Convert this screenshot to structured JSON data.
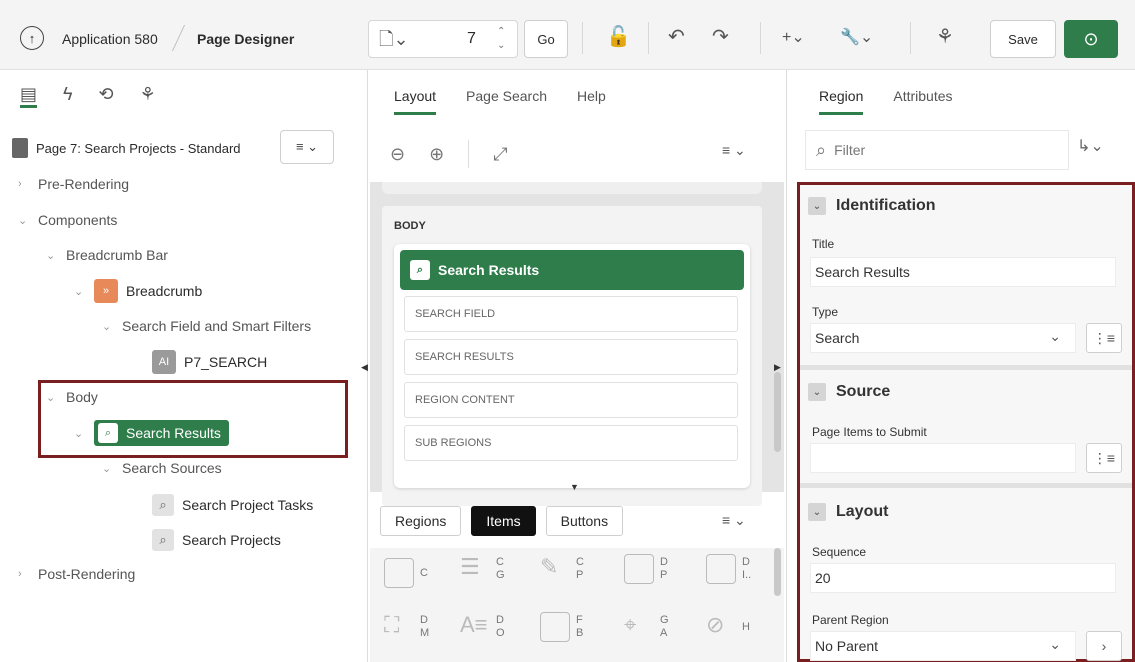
{
  "header": {
    "app_name": "Application 580",
    "page_designer": "Page Designer",
    "page_number": "7",
    "go_label": "Go",
    "save_label": "Save",
    "add_label": "+⌄",
    "wrench_label": "🔧⌄"
  },
  "left": {
    "page_label": "Page 7: Search Projects - Standard",
    "tree": [
      {
        "label": "Pre-Rendering",
        "level": 0,
        "chev": "›"
      },
      {
        "label": "Components",
        "level": 0,
        "chev": "⌄"
      },
      {
        "label": "Breadcrumb Bar",
        "level": 1,
        "chev": "⌄"
      },
      {
        "label": "Breadcrumb",
        "level": 2,
        "chev": "⌄"
      },
      {
        "label": "Search Field and Smart Filters",
        "level": 3,
        "chev": "⌄"
      },
      {
        "label": "P7_SEARCH",
        "level": 4,
        "chev": ""
      },
      {
        "label": "Body",
        "level": 1,
        "chev": "⌄"
      },
      {
        "label": "Search Results",
        "level": 2,
        "chev": "⌄"
      },
      {
        "label": "Search Sources",
        "level": 3,
        "chev": "⌄"
      },
      {
        "label": "Search Project Tasks",
        "level": 4,
        "chev": ""
      },
      {
        "label": "Search Projects",
        "level": 4,
        "chev": ""
      },
      {
        "label": "Post-Rendering",
        "level": 0,
        "chev": "›"
      }
    ]
  },
  "middle": {
    "tabs": [
      "Layout",
      "Page Search",
      "Help"
    ],
    "body_label": "BODY",
    "card_title": "Search Results",
    "slots": [
      "SEARCH FIELD",
      "SEARCH RESULTS",
      "REGION CONTENT",
      "SUB REGIONS"
    ],
    "gallery_tabs": [
      "Regions",
      "Items",
      "Buttons"
    ],
    "gallery_items": [
      {
        "l1": "C",
        "l2": ""
      },
      {
        "l1": "C",
        "l2": "G"
      },
      {
        "l1": "C",
        "l2": "P"
      },
      {
        "l1": "D",
        "l2": "P"
      },
      {
        "l1": "D",
        "l2": "I.."
      },
      {
        "l1": "D",
        "l2": "M"
      },
      {
        "l1": "D",
        "l2": "O"
      },
      {
        "l1": "F",
        "l2": "B"
      },
      {
        "l1": "G",
        "l2": "A"
      },
      {
        "l1": "H",
        "l2": ""
      }
    ]
  },
  "right": {
    "tabs": [
      "Region",
      "Attributes"
    ],
    "filter_placeholder": "Filter",
    "sections": {
      "identification": "Identification",
      "source": "Source",
      "layout": "Layout"
    },
    "title_label": "Title",
    "title_value": "Search Results",
    "type_label": "Type",
    "type_value": "Search",
    "items_submit_label": "Page Items to Submit",
    "items_submit_value": "",
    "sequence_label": "Sequence",
    "sequence_value": "20",
    "parent_label": "Parent Region",
    "parent_value": "No Parent"
  },
  "colors": {
    "accent_green": "#2f7d4b",
    "highlight_red": "#7a1f1f"
  }
}
